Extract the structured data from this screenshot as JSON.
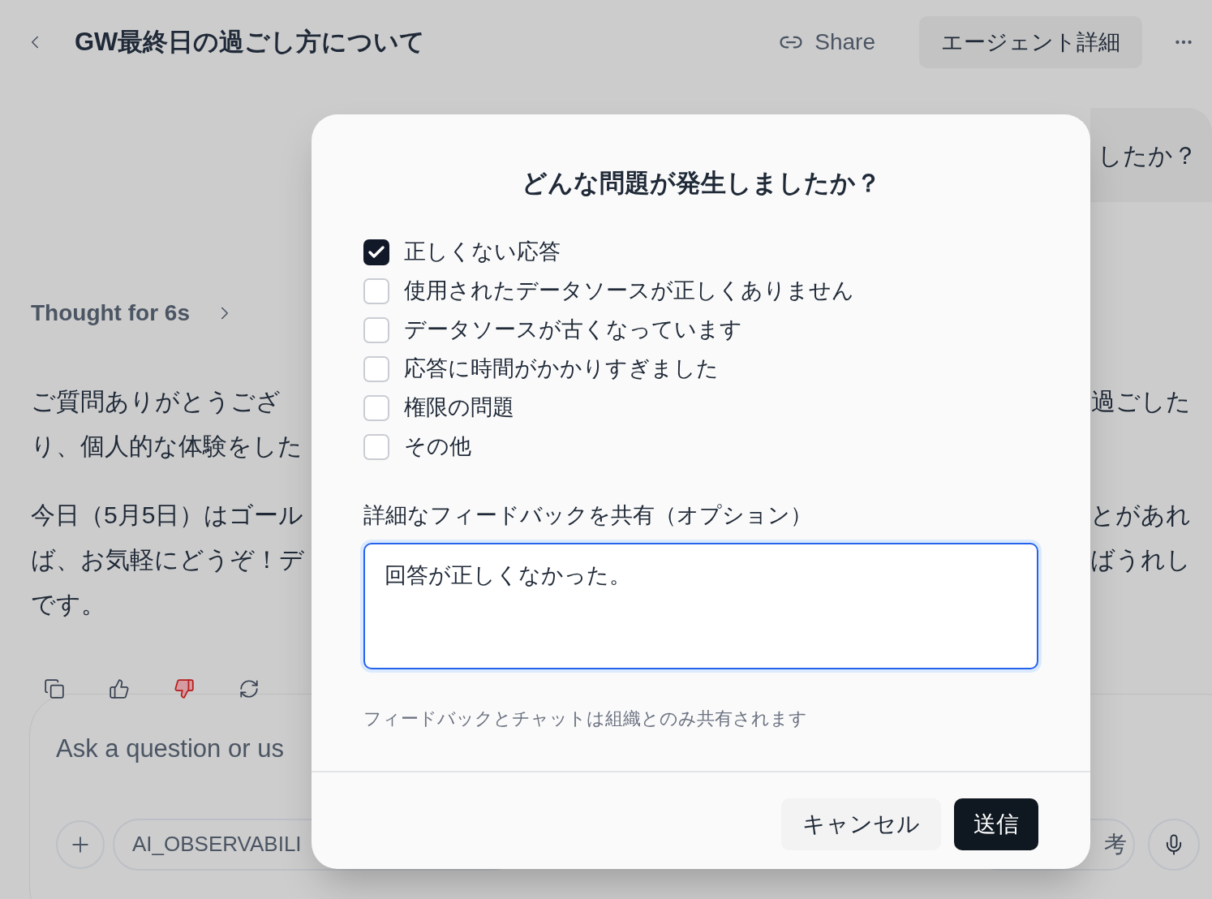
{
  "header": {
    "title": "GW最終日の過ごし方について",
    "share": "Share",
    "agent_button": "エージェント詳細"
  },
  "user_message": {
    "text": "したか？"
  },
  "thought": {
    "label": "Thought for 6s",
    "expanded": false
  },
  "answer": {
    "paragraphs": [
      [
        {
          "left": "ご質問ありがとうござ",
          "right": "過ごした"
        },
        {
          "left": "り、個人的な体験をした"
        }
      ],
      [
        {
          "left": "今日（5月5日）はゴール",
          "right": "とがあれ"
        },
        {
          "left": "ば、お気軽にどうぞ！デ",
          "right": "ばうれし"
        },
        {
          "left": "です。"
        }
      ]
    ]
  },
  "message_actions": [
    {
      "kind": "copy",
      "selected": false
    },
    {
      "kind": "like",
      "selected": false
    },
    {
      "kind": "dislike",
      "selected": true
    },
    {
      "kind": "regenerate",
      "selected": false
    }
  ],
  "composer": {
    "placeholder": "Ask a question or us",
    "source_chip": "AI_OBSERVABILI",
    "mode_chip": "考"
  },
  "dialog": {
    "title": "どんな問題が発生しましたか？",
    "options": [
      {
        "label": "正しくない応答",
        "checked": true
      },
      {
        "label": "使用されたデータソースが正しくありません",
        "checked": false
      },
      {
        "label": "データソースが古くなっています",
        "checked": false
      },
      {
        "label": "応答に時間がかかりすぎました",
        "checked": false
      },
      {
        "label": "権限の問題",
        "checked": false
      },
      {
        "label": "その他",
        "checked": false
      }
    ],
    "details_label": "詳細なフィードバックを共有（オプション）",
    "details_value": "回答が正しくなかった。",
    "note": "フィードバックとチャットは組織とのみ共有されます",
    "buttons": [
      {
        "label": "キャンセル",
        "kind": "secondary"
      },
      {
        "label": "送信",
        "kind": "primary"
      }
    ]
  }
}
